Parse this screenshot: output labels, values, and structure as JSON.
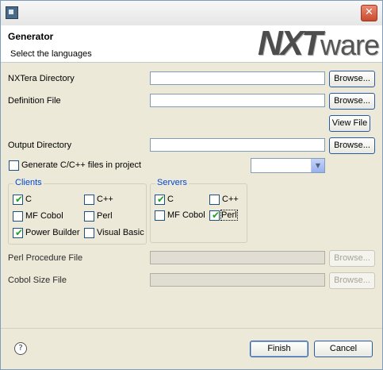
{
  "window": {
    "icon": "app-icon",
    "close_glyph": "✕"
  },
  "banner": {
    "title": "Generator",
    "subtitle": "Select the languages",
    "logo_nxt": "NXT",
    "logo_ware": "ware"
  },
  "form": {
    "nxtera_label": "NXTera Directory",
    "nxtera_value": "",
    "definition_label": "Definition File",
    "definition_value": "",
    "view_file_label": "View File",
    "output_label": "Output Directory",
    "output_value": "",
    "browse_label": "Browse...",
    "generate_label": "Generate C/C++ files in project",
    "generate_checked": false,
    "project_select_value": "",
    "perl_proc_label": "Perl Procedure File",
    "cobol_size_label": "Cobol Size File"
  },
  "clients": {
    "title": "Clients",
    "items": [
      {
        "label": "C",
        "checked": true
      },
      {
        "label": "C++",
        "checked": false
      },
      {
        "label": "MF Cobol",
        "checked": false
      },
      {
        "label": "Perl",
        "checked": false
      },
      {
        "label": "Power Builder",
        "checked": true
      },
      {
        "label": "Visual Basic",
        "checked": false
      }
    ]
  },
  "servers": {
    "title": "Servers",
    "items": [
      {
        "label": "C",
        "checked": true
      },
      {
        "label": "C++",
        "checked": false
      },
      {
        "label": "MF Cobol",
        "checked": false
      },
      {
        "label": "Perl",
        "checked": true
      }
    ]
  },
  "footer": {
    "help_glyph": "?",
    "finish_label": "Finish",
    "cancel_label": "Cancel"
  }
}
